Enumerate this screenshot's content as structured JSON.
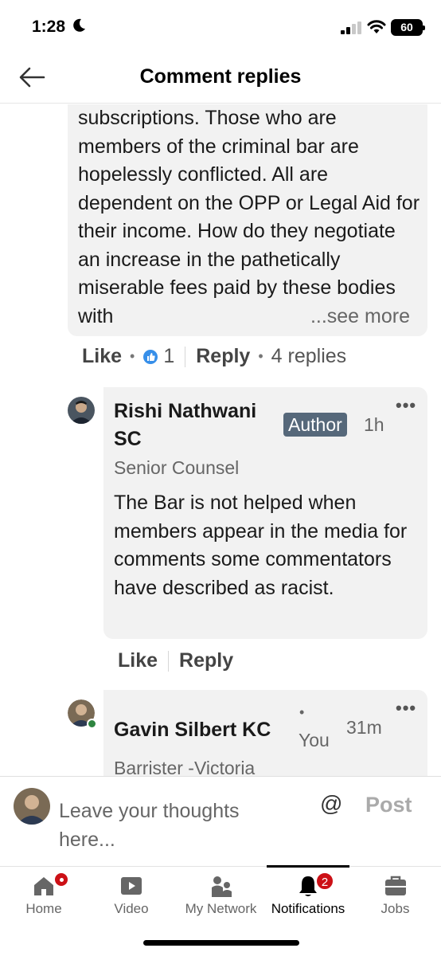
{
  "status": {
    "time": "1:28",
    "battery": "60"
  },
  "header": {
    "title": "Comment replies"
  },
  "parent_comment": {
    "text": "subscriptions. Those who are members of the criminal bar are hopelessly conflicted. All are dependent on the OPP or Legal Aid for their income. How do they negotiate an increase in the pathetically miserable fees paid by these bodies with",
    "see_more": "...see more",
    "like_label": "Like",
    "reaction_count": "1",
    "reply_label": "Reply",
    "replies_count": "4 replies"
  },
  "reply1": {
    "name_line1": "Rishi Nathwani",
    "name_line2": "SC",
    "badge": "Author",
    "time": "1h",
    "more": "•••",
    "headline": "Senior Counsel",
    "body": "The Bar is  not helped when members appear in the media for comments some commentators have described as racist.",
    "like_label": "Like",
    "reply_label": "Reply"
  },
  "reply2": {
    "name": "Gavin Silbert  KC",
    "you_dot": "•",
    "you_label": "You",
    "time": "31m",
    "more": "•••",
    "headline": "Barrister -Victoria"
  },
  "composer": {
    "placeholder": "Leave your thoughts here...",
    "at": "@",
    "post": "Post"
  },
  "tabs": [
    {
      "label": "Home",
      "icon": "home-icon",
      "badge": ""
    },
    {
      "label": "Video",
      "icon": "video-icon"
    },
    {
      "label": "My Network",
      "icon": "network-icon"
    },
    {
      "label": "Notifications",
      "icon": "bell-icon",
      "badge": "2",
      "active": true
    },
    {
      "label": "Jobs",
      "icon": "briefcase-icon"
    }
  ],
  "colors": {
    "author_badge": "#56687a",
    "notification_badge": "#cc1016",
    "online": "#2e8540"
  }
}
